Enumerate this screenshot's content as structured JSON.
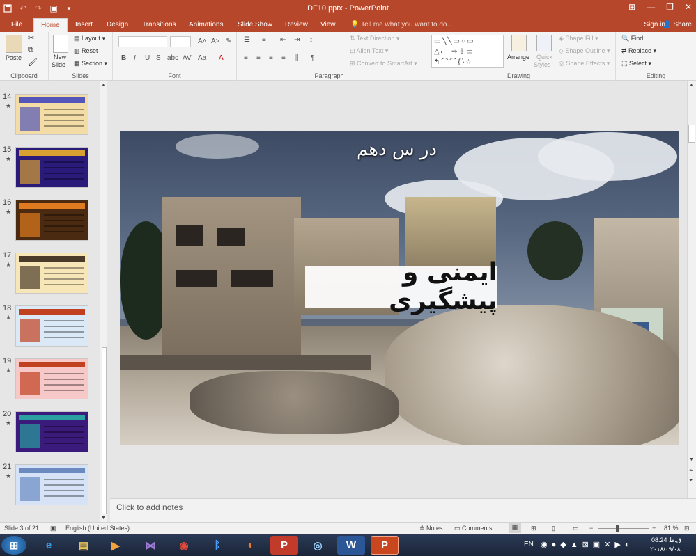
{
  "titlebar": {
    "title": "DF10.pptx - PowerPoint"
  },
  "tabs": [
    "File",
    "Home",
    "Insert",
    "Design",
    "Transitions",
    "Animations",
    "Slide Show",
    "Review",
    "View"
  ],
  "tell_me": "Tell me what you want to do...",
  "sign_in": "Sign in",
  "share": "Share",
  "ribbon": {
    "clipboard": {
      "paste": "Paste",
      "label": "Clipboard"
    },
    "slides": {
      "new_slide": "New",
      "new_slide2": "Slide",
      "layout": "Layout",
      "reset": "Reset",
      "section": "Section",
      "label": "Slides"
    },
    "font": {
      "label": "Font"
    },
    "paragraph": {
      "text_direction": "Text Direction",
      "align_text": "Align Text",
      "convert_smartart": "Convert to SmartArt",
      "label": "Paragraph"
    },
    "drawing": {
      "arrange": "Arrange",
      "quick": "Quick",
      "styles": "Styles",
      "shape_fill": "Shape Fill",
      "shape_outline": "Shape Outline",
      "shape_effects": "Shape Effects",
      "label": "Drawing"
    },
    "editing": {
      "find": "Find",
      "replace": "Replace",
      "select": "Select",
      "label": "Editing"
    }
  },
  "thumbnails": [
    {
      "num": "14",
      "colors": {
        "bg": "#f3dca6",
        "band": "#5356b8"
      }
    },
    {
      "num": "15",
      "colors": {
        "bg": "#2a1a7a",
        "band": "#d8a030"
      }
    },
    {
      "num": "16",
      "colors": {
        "bg": "#4a2a10",
        "band": "#e07a20"
      }
    },
    {
      "num": "17",
      "colors": {
        "bg": "#f7e7b8",
        "band": "#4a3a2a"
      }
    },
    {
      "num": "18",
      "colors": {
        "bg": "#dbe8f5",
        "band": "#c04020"
      }
    },
    {
      "num": "19",
      "colors": {
        "bg": "#f7c8c8",
        "band": "#c04020"
      }
    },
    {
      "num": "20",
      "colors": {
        "bg": "#3a1a7a",
        "band": "#2aa0a0"
      }
    },
    {
      "num": "21",
      "colors": {
        "bg": "#d6e3f7",
        "band": "#6a8ac0"
      }
    }
  ],
  "slide": {
    "subtitle": "در س دهم",
    "title": "ایمنی و پیشگیری"
  },
  "notes_placeholder": "Click to add notes",
  "status": {
    "slide_info": "Slide 3 of 21",
    "language": "English (United States)",
    "notes": "Notes",
    "comments": "Comments",
    "zoom": "81 %"
  },
  "tray": {
    "lang": "EN",
    "time": "08:24 ق.ظ",
    "date": "۲۰۱۸/۰۹/۰۸"
  }
}
